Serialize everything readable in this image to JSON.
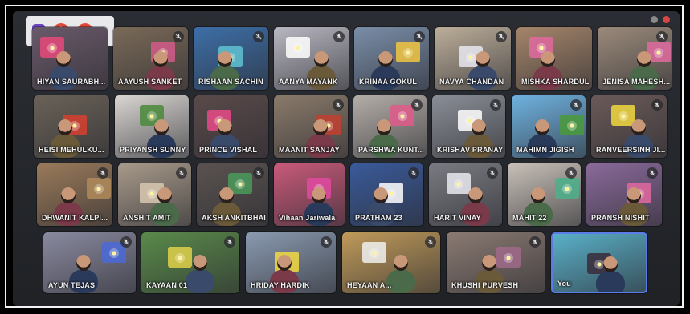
{
  "meeting": {
    "toolbar": {
      "shield_icon": "shield-icon",
      "warning_icon": "warning-icon",
      "record_icon": "record-icon"
    },
    "participants": [
      {
        "name": "HIYAN SAURABH...",
        "row": 0,
        "col": 0,
        "bg": "#6a5a6a",
        "accent": "#e9497a",
        "muted": false
      },
      {
        "name": "AAYUSH SANKET",
        "row": 0,
        "col": 1,
        "bg": "#7a6a58",
        "accent": "#d35a8a",
        "muted": true
      },
      {
        "name": "RISHAAN SACHIN",
        "row": 0,
        "col": 2,
        "bg": "#3d6fa8",
        "accent": "#5fc2d1",
        "muted": true
      },
      {
        "name": "AANYA MAYANK",
        "row": 0,
        "col": 3,
        "bg": "#b9b8c2",
        "accent": "#ffffff",
        "muted": true
      },
      {
        "name": "KRINAA GOKUL",
        "row": 0,
        "col": 4,
        "bg": "#7a8ea8",
        "accent": "#f2c641",
        "muted": true
      },
      {
        "name": "NAVYA CHANDAN",
        "row": 0,
        "col": 5,
        "bg": "#bcae9a",
        "accent": "#e8e8f0",
        "muted": true
      },
      {
        "name": "MISHKA SHARDUL",
        "row": 0,
        "col": 6,
        "bg": "#a5856a",
        "accent": "#e06aa0",
        "muted": false
      },
      {
        "name": "JENISA MAHESH...",
        "row": 0,
        "col": 7,
        "bg": "#9b8a7a",
        "accent": "#e06aa0",
        "muted": true
      },
      {
        "name": "HEISI MEHULKU...",
        "row": 1,
        "col": 0,
        "bg": "#6a6258",
        "accent": "#d7402f",
        "muted": false
      },
      {
        "name": "PRIYANSH SUNNY",
        "row": 1,
        "col": 1,
        "bg": "#d9d6d2",
        "accent": "#4a8a3a",
        "muted": false
      },
      {
        "name": "PRINCE VISHAL",
        "row": 1,
        "col": 2,
        "bg": "#5a4a4a",
        "accent": "#e94a88",
        "muted": false
      },
      {
        "name": "MAANIT SANJAY",
        "row": 1,
        "col": 3,
        "bg": "#8a7a6a",
        "accent": "#c2402f",
        "muted": true
      },
      {
        "name": "PARSHWA KUNT...",
        "row": 1,
        "col": 4,
        "bg": "#b4aea8",
        "accent": "#e05a8a",
        "muted": true
      },
      {
        "name": "KRISHAV PRANAY",
        "row": 1,
        "col": 5,
        "bg": "#8a8e96",
        "accent": "#ffffff",
        "muted": true
      },
      {
        "name": "MAHIMN JIGISH",
        "row": 1,
        "col": 6,
        "bg": "#6fb2e0",
        "accent": "#4a9a3a",
        "muted": true
      },
      {
        "name": "RANVEERSINH JI...",
        "row": 1,
        "col": 7,
        "bg": "#6a5a58",
        "accent": "#f2d841",
        "muted": true
      },
      {
        "name": "DHWANIT KALPI...",
        "row": 2,
        "col": 0,
        "bg": "#9a7a5a",
        "accent": "#b08a5a",
        "muted": true
      },
      {
        "name": "ANSHIT AMIT",
        "row": 2,
        "col": 1,
        "bg": "#a89a8a",
        "accent": "#d8c8b0",
        "muted": true
      },
      {
        "name": "AKSH ANKITBHAI",
        "row": 2,
        "col": 2,
        "bg": "#5a5250",
        "accent": "#4a9a5a",
        "muted": true
      },
      {
        "name": "Vihaan Jariwala",
        "row": 2,
        "col": 3,
        "bg": "#c85a7a",
        "accent": "#e04aa0",
        "muted": false
      },
      {
        "name": "PRATHAM 23",
        "row": 2,
        "col": 4,
        "bg": "#3a5a9a",
        "accent": "#ffffff",
        "muted": true
      },
      {
        "name": "HARIT VINAY",
        "row": 2,
        "col": 5,
        "bg": "#7a7a82",
        "accent": "#e9e9f0",
        "muted": true
      },
      {
        "name": "MAHIT 22",
        "row": 2,
        "col": 6,
        "bg": "#c8c0b8",
        "accent": "#4ab08a",
        "muted": true
      },
      {
        "name": "PRANSH NISHIT",
        "row": 2,
        "col": 7,
        "bg": "#8a6a9a",
        "accent": "#e06aa0",
        "muted": true
      },
      {
        "name": "AYUN TEJAS",
        "row": 3,
        "col": 0,
        "bg": "#8a8aa0",
        "accent": "#4a6ad8",
        "muted": true
      },
      {
        "name": "KAYAAN 01",
        "row": 3,
        "col": 1,
        "bg": "#5a8a4a",
        "accent": "#e0d04a",
        "muted": true
      },
      {
        "name": "HRIDAY HARDIK",
        "row": 3,
        "col": 2,
        "bg": "#8a9ab0",
        "accent": "#f2d841",
        "muted": true
      },
      {
        "name": "HEYAAN A...",
        "row": 3,
        "col": 3,
        "bg": "#c09a5a",
        "accent": "#f0f0f0",
        "muted": true
      },
      {
        "name": "KHUSHI PURVESH",
        "row": 3,
        "col": 4,
        "bg": "#8a7a72",
        "accent": "#a06a8a",
        "muted": true
      },
      {
        "name": "You",
        "row": 3,
        "col": 5,
        "bg": "#5ab0c8",
        "accent": "#3a2a3a",
        "muted": false,
        "self": true
      }
    ]
  }
}
